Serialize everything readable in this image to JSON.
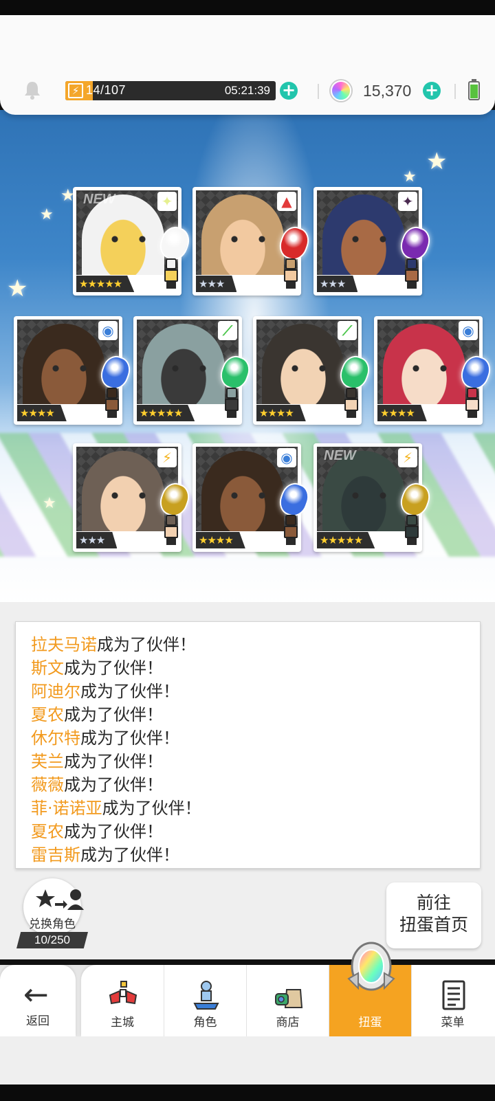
{
  "header": {
    "energy_current": "14",
    "energy_sep_max": "/107",
    "energy_fraction": 0.13,
    "energy_timer": "05:21:39",
    "gem_count": "15,370"
  },
  "colors": {
    "accent_orange": "#f4a62a",
    "name_orange": "#f29a1e",
    "plus_teal": "#22c5ac",
    "nav_active": "#f5a321"
  },
  "cards": [
    {
      "row": 1,
      "new": "NEW",
      "element": "light",
      "stars": "★★★★★",
      "rarity": 5
    },
    {
      "row": 1,
      "new": "",
      "element": "fire",
      "stars": "★★★",
      "rarity": 3
    },
    {
      "row": 1,
      "new": "",
      "element": "dark",
      "stars": "★★★",
      "rarity": 3
    },
    {
      "row": 2,
      "new": "",
      "element": "water",
      "stars": "★★★★",
      "rarity": 4
    },
    {
      "row": 2,
      "new": "",
      "element": "earth",
      "stars": "★★★★★",
      "rarity": 5
    },
    {
      "row": 2,
      "new": "",
      "element": "earth",
      "stars": "★★★★",
      "rarity": 4
    },
    {
      "row": 2,
      "new": "",
      "element": "water",
      "stars": "★★★★",
      "rarity": 4
    },
    {
      "row": 3,
      "new": "",
      "element": "basic",
      "stars": "★★★",
      "rarity": 3
    },
    {
      "row": 3,
      "new": "",
      "element": "water",
      "stars": "★★★★",
      "rarity": 4
    },
    {
      "row": 3,
      "new": "NEW",
      "element": "basic",
      "stars": "★★★★★",
      "rarity": 5
    }
  ],
  "log": {
    "suffix": "成为了伙伴！",
    "names": [
      "拉夫马诺",
      "斯文",
      "阿迪尔",
      "夏农",
      "休尔特",
      "芙兰",
      "薇薇",
      "菲·诺诺亚",
      "夏农",
      "雷吉斯"
    ]
  },
  "exchange": {
    "label": "兑换角色",
    "count": "10/250"
  },
  "goto_button": {
    "line1": "前往",
    "line2": "扭蛋首页"
  },
  "nav": {
    "back": "返回",
    "items": [
      "主城",
      "角色",
      "商店",
      "扭蛋",
      "菜单"
    ],
    "active": "扭蛋"
  }
}
